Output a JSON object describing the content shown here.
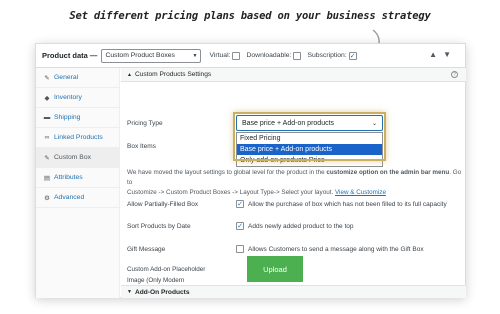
{
  "banner": {
    "text": "Set different pricing plans based on your business strategy"
  },
  "header": {
    "title": "Product data —",
    "product_type": "Custom Product Boxes",
    "options": [
      {
        "label": "Virtual:",
        "checked": false
      },
      {
        "label": "Downloadable:",
        "checked": false
      },
      {
        "label": "Subscription:",
        "checked": true
      }
    ],
    "collapse_up": "▲",
    "collapse_down": "▼"
  },
  "sidebar": {
    "items": [
      {
        "label": "General",
        "icon": "wrench-icon",
        "glyph": "✎"
      },
      {
        "label": "Inventory",
        "icon": "tag-icon",
        "glyph": "◆"
      },
      {
        "label": "Shipping",
        "icon": "truck-icon",
        "glyph": "▬"
      },
      {
        "label": "Linked Products",
        "icon": "link-icon",
        "glyph": "∞"
      },
      {
        "label": "Custom Box",
        "icon": "wrench-icon",
        "glyph": "✎"
      },
      {
        "label": "Attributes",
        "icon": "list-icon",
        "glyph": "▤"
      },
      {
        "label": "Advanced",
        "icon": "gear-icon",
        "glyph": "⚙"
      }
    ]
  },
  "section": {
    "title": "Custom Products Settings",
    "pricing_type_label": "Pricing Type",
    "pricing_type_value": "Base price + Add-on products",
    "pricing_options": [
      "Fixed Pricing",
      "Base price + Add-on products",
      "Only add-on products Price"
    ],
    "box_items_label": "Box Items",
    "note_line1_start": "We have moved the layout settings to global level for the product in the",
    "note_line1_bold": "customize option on the admin bar menu",
    "note_line1_end": ". Go to",
    "note_line2_start": "Customize -> Custom Product Boxes -> Layout Type-> Select your layout.",
    "note_link": "View & Customize",
    "partial_label": "Allow Partially-Filled Box",
    "partial_text": "Allow the purchase of box which has not been filled to its full capacity",
    "sort_label": "Sort Products by Date",
    "sort_text": "Adds newly added product to the top",
    "gift_label": "Gift Message",
    "gift_text": "Allows Customers to send a message along with the Gift Box",
    "upload_label": "Custom Add-on Placeholder Image (Only Modern Layout)",
    "upload_button": "Upload"
  },
  "section2": {
    "title": "Add-On Products"
  },
  "colors": {
    "accent": "#2271b1",
    "upload": "#4caf50",
    "selected": "#1a64c9",
    "highlight": "#c9b063"
  }
}
